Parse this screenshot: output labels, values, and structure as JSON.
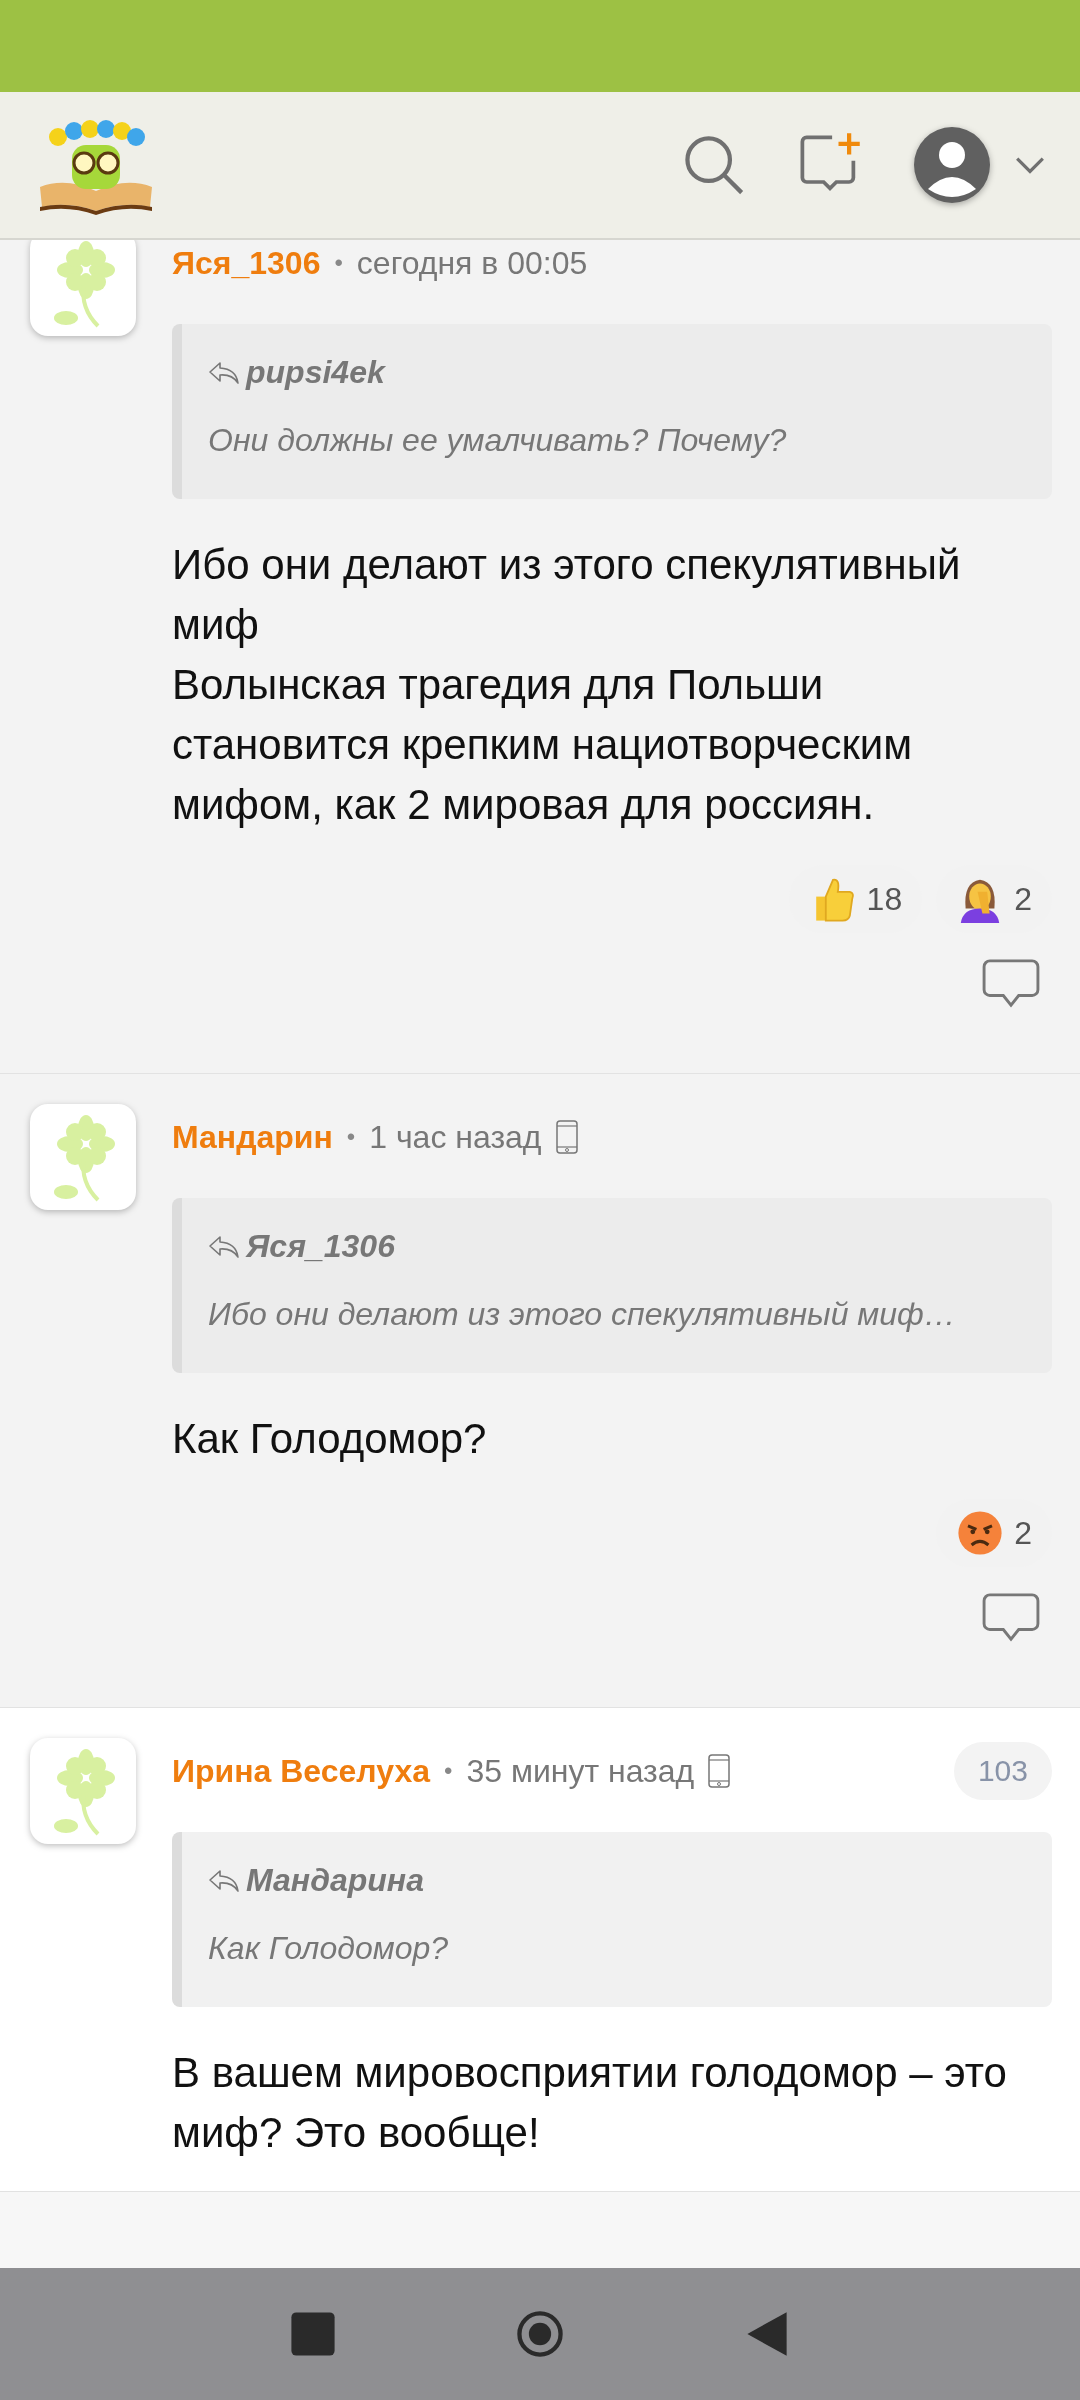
{
  "comments": [
    {
      "author": "Яся_1306",
      "separator": "•",
      "time": "сегодня в 00:05",
      "mobile": false,
      "highlighted": false,
      "quote": {
        "author": "pupsi4ek",
        "text": "Они должны ее умалчивать? Почему?"
      },
      "text": "Ибо они делают из этого спекулятивный миф\nВолынская трагедия для Польши становится крепким нациотворческим мифом, как 2 мировая для россиян.",
      "reactions": [
        {
          "kind": "like",
          "count": "18"
        },
        {
          "kind": "facepalm",
          "count": "2"
        }
      ],
      "reply_icon": true
    },
    {
      "author": "Мандарин",
      "separator": "•",
      "time": "1 час назад",
      "mobile": true,
      "highlighted": false,
      "quote": {
        "author": "Яся_1306",
        "text": "Ибо они делают из этого спекулятивный миф…"
      },
      "text": "Как Голодомор?",
      "reactions": [
        {
          "kind": "angry",
          "count": "2"
        }
      ],
      "reply_icon": true
    },
    {
      "author": "Ирина Веселуха",
      "separator": "•",
      "time": "35 минут назад",
      "mobile": true,
      "highlighted": true,
      "badge": "103",
      "quote": {
        "author": "Мандарина",
        "text": "Как Голодомор?"
      },
      "text": "В вашем мировосприятии голодомор – это миф? Это вообще!",
      "reply_icon": false
    }
  ]
}
